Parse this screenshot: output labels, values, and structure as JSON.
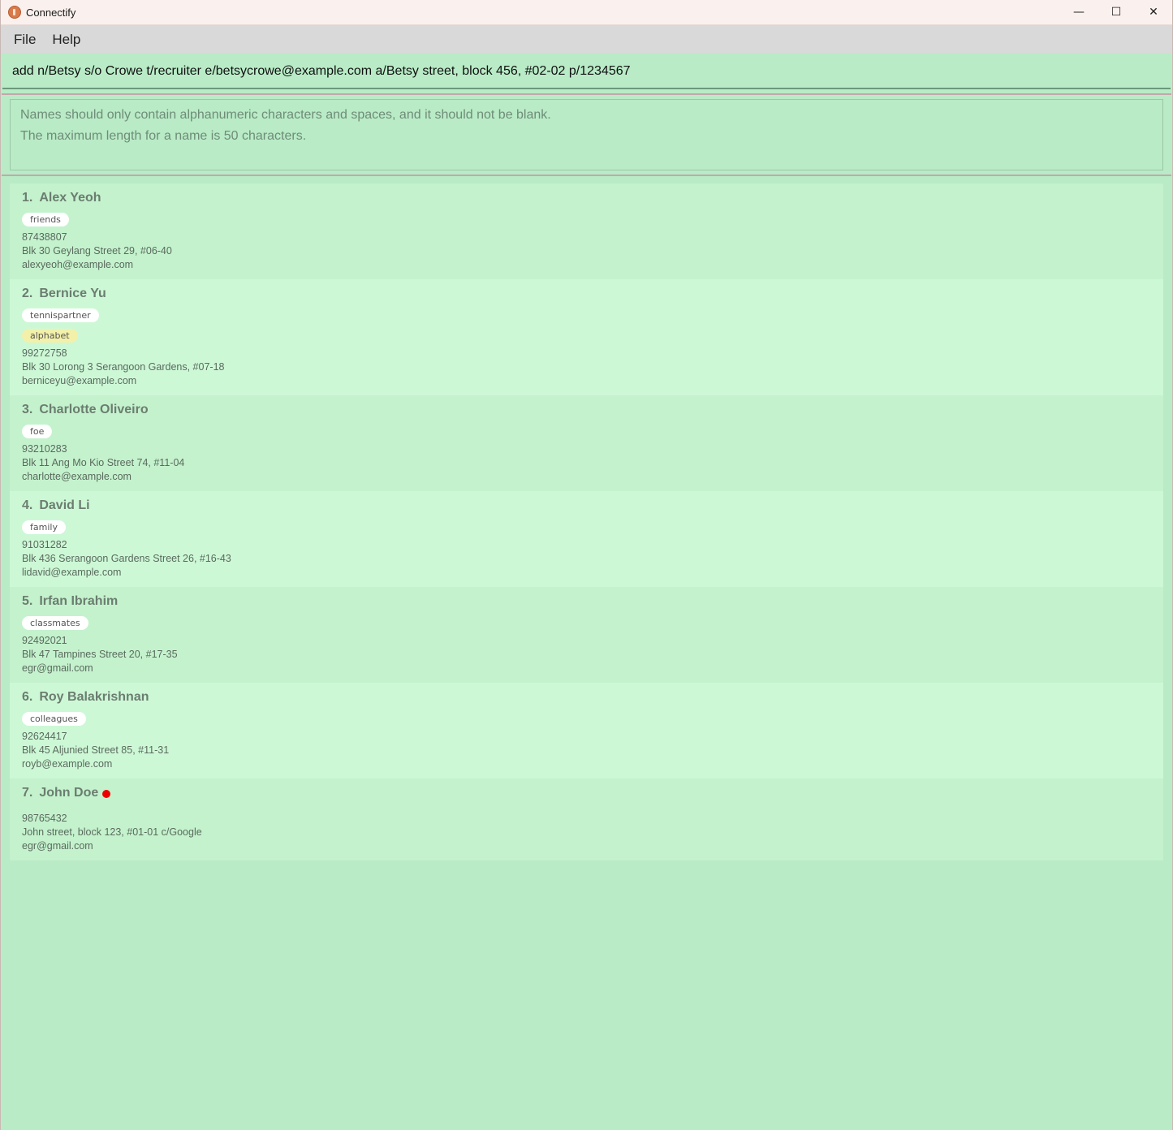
{
  "window": {
    "title": "Connectify",
    "minimize_glyph": "—",
    "maximize_glyph": "☐",
    "close_glyph": "✕"
  },
  "menu": {
    "file_label": "File",
    "help_label": "Help"
  },
  "command": {
    "value": "add n/Betsy s/o Crowe t/recruiter e/betsycrowe@example.com a/Betsy street, block 456, #02-02 p/1234567"
  },
  "result": {
    "line1": "Names should only contain alphanumeric characters and spaces, and it should not be blank.",
    "line2": "The maximum length for a name is 50 characters."
  },
  "persons": [
    {
      "index": "1.",
      "name": "Alex Yeoh",
      "tags": [
        "friends"
      ],
      "phone": "87438807",
      "address": "Blk 30 Geylang Street 29, #06-40",
      "email": "alexyeoh@example.com"
    },
    {
      "index": "2.",
      "name": "Bernice Yu",
      "tags": [
        "tennispartner"
      ],
      "highlight_tags": [
        "alphabet"
      ],
      "phone": "99272758",
      "address": "Blk 30 Lorong 3 Serangoon Gardens, #07-18",
      "email": "berniceyu@example.com"
    },
    {
      "index": "3.",
      "name": "Charlotte Oliveiro",
      "tags": [
        "foe"
      ],
      "phone": "93210283",
      "address": "Blk 11 Ang Mo Kio Street 74, #11-04",
      "email": "charlotte@example.com"
    },
    {
      "index": "4.",
      "name": "David Li",
      "tags": [
        "family"
      ],
      "phone": "91031282",
      "address": "Blk 436 Serangoon Gardens Street 26, #16-43",
      "email": "lidavid@example.com"
    },
    {
      "index": "5.",
      "name": "Irfan Ibrahim",
      "tags": [
        "classmates"
      ],
      "phone": "92492021",
      "address": "Blk 47 Tampines Street 20, #17-35",
      "email": "egr@gmail.com"
    },
    {
      "index": "6.",
      "name": "Roy Balakrishnan",
      "tags": [
        "colleagues"
      ],
      "phone": "92624417",
      "address": "Blk 45 Aljunied Street 85, #11-31",
      "email": "royb@example.com"
    },
    {
      "index": "7.",
      "name": "John Doe",
      "tags": [],
      "status_dot_color": "#ee0000",
      "phone": "98765432",
      "address": "John street, block 123, #01-01 c/Google",
      "email": "egr@gmail.com"
    }
  ],
  "colors": {
    "background": "#b8ebc6",
    "card_odd": "#c4f2cd",
    "card_even": "#cdf8d6",
    "tag_highlight": "#f3f0a9"
  }
}
